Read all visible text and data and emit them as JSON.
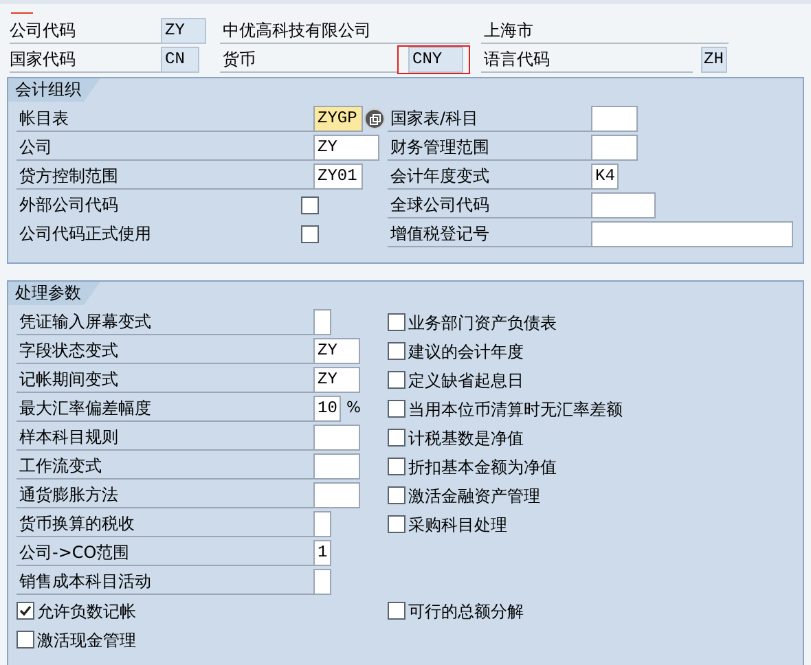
{
  "header": {
    "company_code": {
      "label": "公司代码",
      "value": "ZY"
    },
    "company_name": "中优高科技有限公司",
    "city": "上海市",
    "country_code": {
      "label": "国家代码",
      "value": "CN"
    },
    "currency": {
      "label": "货币",
      "value": "CNY",
      "highlighted": true
    },
    "language": {
      "label": "语言代码",
      "value": "ZH"
    }
  },
  "groups": [
    {
      "title": "会计组织",
      "rows": [
        {
          "left": {
            "kind": "field",
            "label": "帐目表",
            "value": "ZYGP",
            "focused": true
          },
          "right": {
            "kind": "field",
            "label": "国家表/科目"
          }
        },
        {
          "left": {
            "kind": "field",
            "label": "公司",
            "value": "ZY",
            "focused": false
          },
          "right": {
            "kind": "field",
            "label": "财务管理范围"
          }
        },
        {
          "left": {
            "kind": "field",
            "label": "贷方控制范围",
            "value": "ZY01",
            "focused": false
          },
          "right": {
            "kind": "field",
            "label": "会计年度变式",
            "value": "K4"
          }
        },
        {
          "left": {
            "kind": "flag",
            "label": "外部公司代码",
            "checked": false
          },
          "right": {
            "kind": "field",
            "label": "全球公司代码"
          }
        },
        {
          "left": {
            "kind": "flag",
            "label": "公司代码正式使用",
            "checked": false
          },
          "right": {
            "kind": "field",
            "label": "增值税登记号"
          }
        }
      ]
    },
    {
      "title": "处理参数",
      "rows": [
        {
          "left": {
            "kind": "field",
            "label": "凭证输入屏幕变式",
            "focused": false
          },
          "right": {
            "kind": "checkbox",
            "label": "业务部门资产负债表",
            "checked": false
          }
        },
        {
          "left": {
            "kind": "field",
            "label": "字段状态变式",
            "value": "ZY",
            "focused": false
          },
          "right": {
            "kind": "checkbox",
            "label": "建议的会计年度",
            "checked": false
          }
        },
        {
          "left": {
            "kind": "field",
            "label": "记帐期间变式",
            "value": "ZY",
            "focused": false
          },
          "right": {
            "kind": "checkbox",
            "label": "定义缺省起息日",
            "checked": false
          }
        },
        {
          "left": {
            "kind": "field",
            "label": "最大汇率偏差幅度",
            "value": "10",
            "unit": "%",
            "focused": false
          },
          "right": {
            "kind": "checkbox",
            "label": "当用本位币清算时无汇率差额",
            "checked": false
          }
        },
        {
          "left": {
            "kind": "field",
            "label": "样本科目规则",
            "focused": false
          },
          "right": {
            "kind": "checkbox",
            "label": "计税基数是净值",
            "checked": false
          }
        },
        {
          "left": {
            "kind": "field",
            "label": "工作流变式",
            "focused": false
          },
          "right": {
            "kind": "checkbox",
            "label": "折扣基本金额为净值",
            "checked": false
          }
        },
        {
          "left": {
            "kind": "field",
            "label": "通货膨胀方法",
            "focused": false
          },
          "right": {
            "kind": "checkbox",
            "label": "激活金融资产管理",
            "checked": false
          }
        },
        {
          "left": {
            "kind": "field",
            "label": "货币换算的税收",
            "focused": false
          },
          "right": {
            "kind": "checkbox",
            "label": "采购科目处理",
            "checked": false
          }
        },
        {
          "left": {
            "kind": "field",
            "label": "公司->CO范围",
            "value": "1",
            "focused": false
          }
        },
        {
          "left": {
            "kind": "field",
            "label": "销售成本科目活动",
            "focused": false
          }
        },
        {
          "left": {
            "kind": "checkbox",
            "label": "允许负数记帐",
            "checked": true
          },
          "right": {
            "kind": "checkbox",
            "label": "可行的总额分解",
            "checked": false
          }
        },
        {
          "left": {
            "kind": "checkbox",
            "label": "激活现金管理",
            "checked": false
          }
        }
      ]
    }
  ]
}
